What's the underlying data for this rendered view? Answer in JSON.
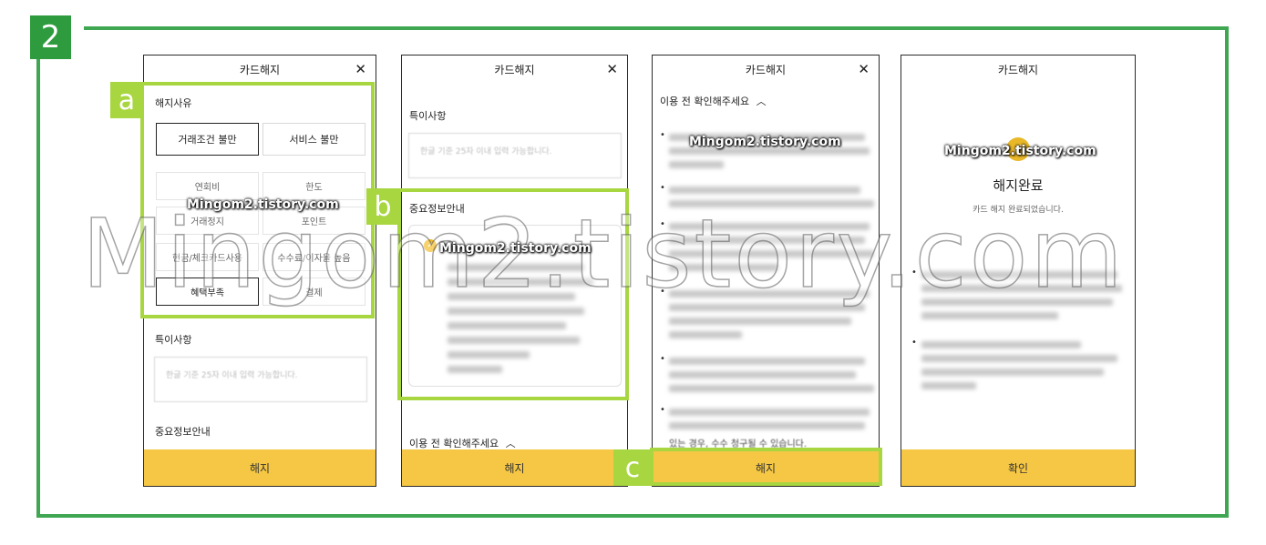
{
  "step_badge": "2",
  "watermark": "Mingom2.tistory.com",
  "big_watermark": "Mingom2.tistory.com",
  "markers": {
    "a": "a",
    "b": "b",
    "c": "c"
  },
  "colors": {
    "accent_yellow": "#f6c744",
    "frame_green": "#3fa652",
    "marker_green": "#a8d640"
  },
  "screen1": {
    "title": "카드해지",
    "close_icon": "close-icon",
    "reason_label": "해지사유",
    "primary_buttons": [
      "거래조건 불만",
      "서비스 불만"
    ],
    "options": [
      "연회비",
      "한도",
      "거래정지",
      "포인트",
      "현금/체크카드사용",
      "수수료/이자율 높음",
      "혜택부족",
      "결제"
    ],
    "notes_label": "특이사항",
    "notes_placeholder": "한글 기준 25자 이내 입력 가능합니다.",
    "info_label": "중요정보안내",
    "submit_label": "해지"
  },
  "screen2": {
    "title": "카드해지",
    "notes_label": "특이사항",
    "notes_placeholder": "한글 기준 25자 이내 입력 가능합니다.",
    "info_label": "중요정보안내",
    "precheck_label": "이용 전 확인해주세요",
    "submit_label": "해지"
  },
  "screen3": {
    "title": "카드해지",
    "precheck_label": "이용 전 확인해주세요",
    "last_line": "있는 경우, 수수 청구될 수 있습니다.",
    "submit_label": "해지"
  },
  "screen4": {
    "title": "카드해지",
    "done_title": "해지완료",
    "done_message": "카드 해지 완료되었습니다.",
    "confirm_label": "확인"
  }
}
